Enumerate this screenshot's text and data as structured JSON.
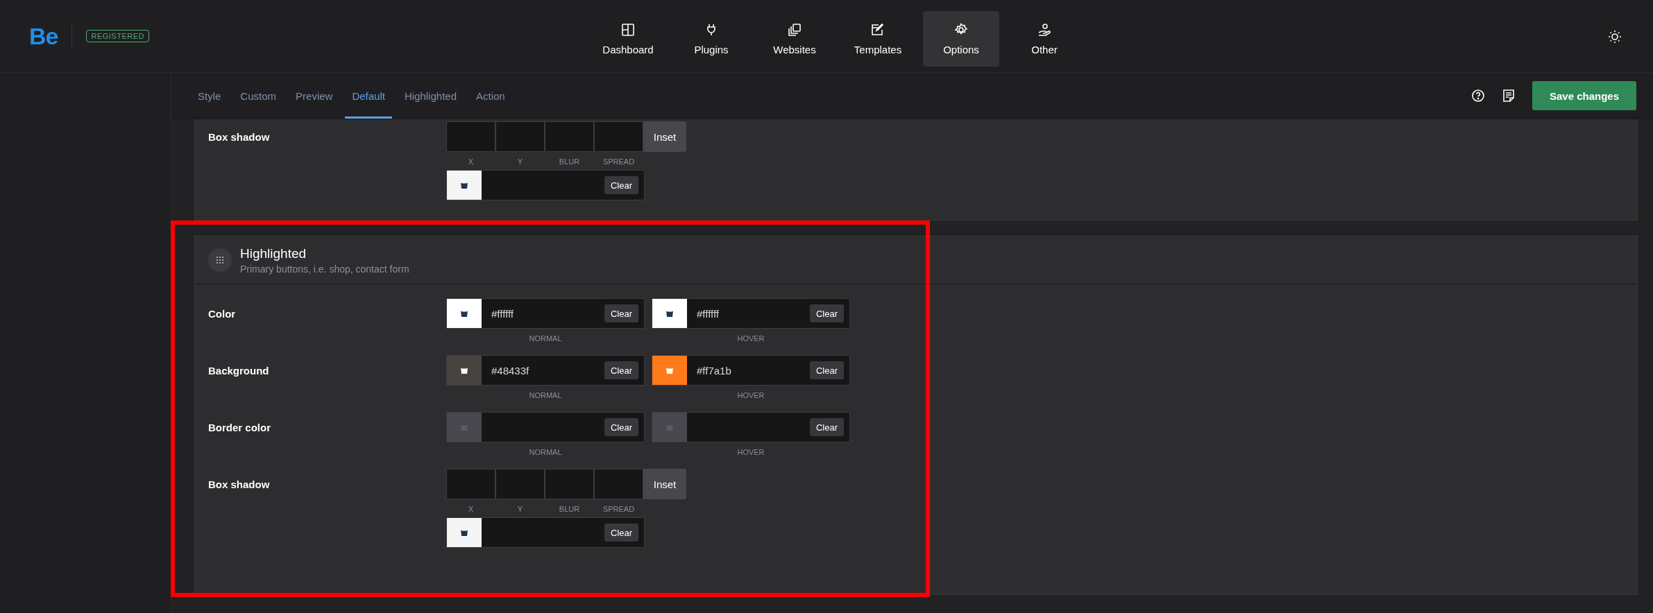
{
  "header": {
    "logo": "Be",
    "badge": "REGISTERED",
    "nav": [
      {
        "label": "Dashboard",
        "selected": false
      },
      {
        "label": "Plugins",
        "selected": false
      },
      {
        "label": "Websites",
        "selected": false
      },
      {
        "label": "Templates",
        "selected": false
      },
      {
        "label": "Options",
        "selected": true
      },
      {
        "label": "Other",
        "selected": false
      }
    ]
  },
  "subnav": {
    "tabs": [
      {
        "label": "Style",
        "selected": false
      },
      {
        "label": "Custom",
        "selected": false
      },
      {
        "label": "Preview",
        "selected": false
      },
      {
        "label": "Default",
        "selected": true
      },
      {
        "label": "Highlighted",
        "selected": false
      },
      {
        "label": "Action",
        "selected": false
      }
    ],
    "save_button": "Save changes"
  },
  "top_section": {
    "rows": [
      {
        "kind": "shadow",
        "label": "Box shadow",
        "fields": [
          "X",
          "Y",
          "BLUR",
          "SPREAD"
        ],
        "inset": "Inset",
        "picker": {
          "color": "#f5f5f5",
          "clear": "Clear"
        }
      }
    ]
  },
  "highlighted": {
    "title": "Highlighted",
    "subtitle": "Primary buttons, i.e. shop, contact form",
    "rows": [
      {
        "kind": "pair",
        "label": "Color",
        "pickers": [
          {
            "color": "#ffffff",
            "value": "#ffffff",
            "clear": "Clear",
            "caption": "NORMAL"
          },
          {
            "color": "#ffffff",
            "value": "#ffffff",
            "clear": "Clear",
            "caption": "HOVER"
          }
        ]
      },
      {
        "kind": "pair",
        "label": "Background",
        "pickers": [
          {
            "color": "#48433f",
            "value": "#48433f",
            "clear": "Clear",
            "caption": "NORMAL"
          },
          {
            "color": "#ff7a1b",
            "value": "#ff7a1b",
            "clear": "Clear",
            "caption": "HOVER"
          }
        ]
      },
      {
        "kind": "pair",
        "label": "Border color",
        "pickers": [
          {
            "color": "#48474d",
            "clear": "Clear",
            "caption": "NORMAL"
          },
          {
            "color": "#48474d",
            "clear": "Clear",
            "caption": "HOVER"
          }
        ]
      },
      {
        "kind": "shadow",
        "label": "Box shadow",
        "fields": [
          "X",
          "Y",
          "BLUR",
          "SPREAD"
        ],
        "inset": "Inset",
        "picker": {
          "color": "#f5f5f5",
          "clear": "Clear"
        }
      }
    ]
  }
}
